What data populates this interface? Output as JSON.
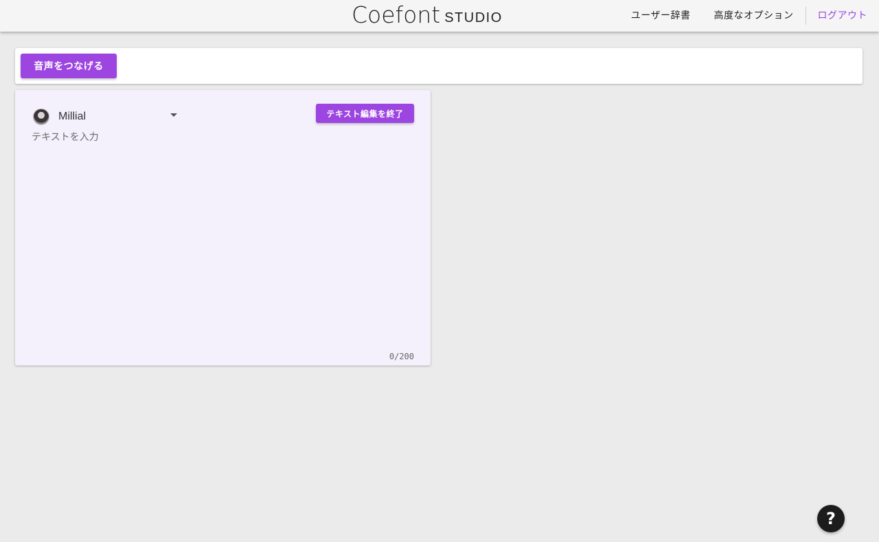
{
  "header": {
    "logo_mark": "Coefont",
    "logo_product": "STUDIO",
    "nav": {
      "user_dictionary": "ユーザー辞書",
      "advanced_options": "高度なオプション",
      "logout": "ログアウト"
    }
  },
  "toolbar": {
    "join_audio_label": "音声をつなげる"
  },
  "editor": {
    "voice": {
      "name": "Millial",
      "icon": "avatar"
    },
    "end_edit_label": "テキスト編集を終了",
    "text": {
      "value": "",
      "placeholder": "テキストを入力"
    },
    "char_count": "0/200"
  },
  "help": {
    "label": "?"
  },
  "colors": {
    "accent": "#9c45e0",
    "editor_background": "#f4f0fc",
    "page_background": "#ebebeb"
  }
}
